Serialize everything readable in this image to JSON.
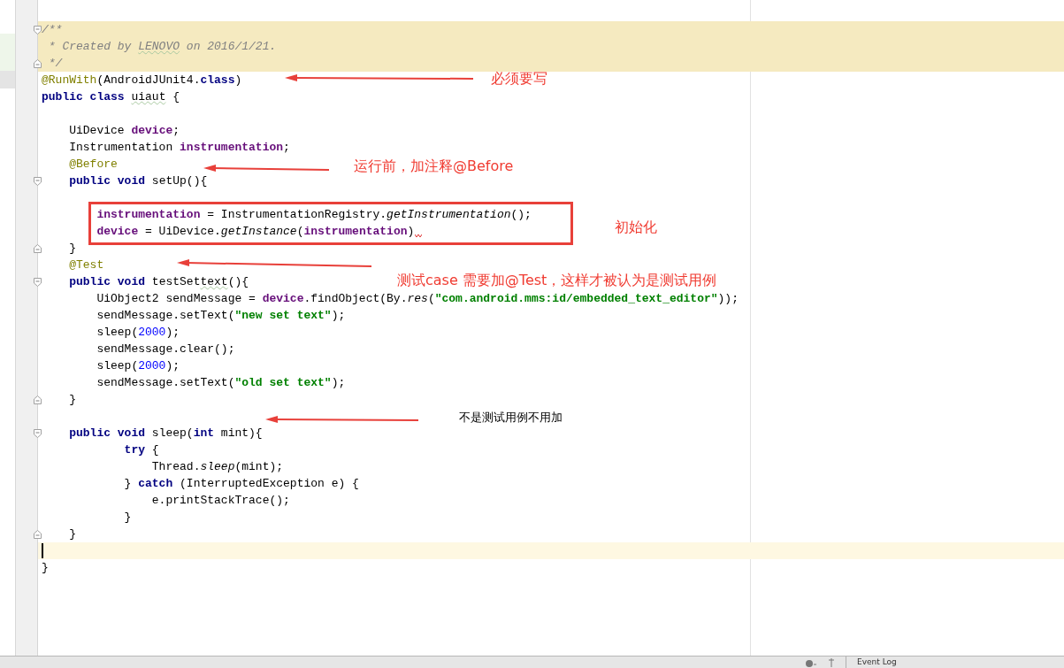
{
  "editor": {
    "lines": [
      {
        "highlighted": true,
        "fold_start": true,
        "tokens": [
          {
            "kind": "comment",
            "text": "/**"
          }
        ]
      },
      {
        "highlighted": true,
        "tokens": [
          {
            "kind": "comment",
            "text": " * Created by "
          },
          {
            "kind": "comment",
            "text": "LENOVO",
            "typo": true
          },
          {
            "kind": "comment",
            "text": " on 2016/1/21."
          }
        ]
      },
      {
        "highlighted": true,
        "fold_end": true,
        "tokens": [
          {
            "kind": "comment",
            "text": " */"
          }
        ]
      },
      {
        "tokens": [
          {
            "kind": "annotation",
            "text": "@RunWith"
          },
          {
            "kind": "plain",
            "text": "(AndroidJUnit4."
          },
          {
            "kind": "keyword",
            "text": "class"
          },
          {
            "kind": "plain",
            "text": ")"
          }
        ]
      },
      {
        "tokens": [
          {
            "kind": "keyword",
            "text": "public class "
          },
          {
            "kind": "plain",
            "text": "uiaut",
            "typo": true
          },
          {
            "kind": "plain",
            "text": " {"
          }
        ]
      },
      {
        "blank_line_before": true,
        "tokens": [
          {
            "kind": "plain",
            "text": "    UiDevice "
          },
          {
            "kind": "field",
            "text": "device"
          },
          {
            "kind": "plain",
            "text": ";"
          }
        ]
      },
      {
        "tokens": [
          {
            "kind": "plain",
            "text": "    Instrumentation "
          },
          {
            "kind": "field",
            "text": "instrumentation"
          },
          {
            "kind": "plain",
            "text": ";"
          }
        ]
      },
      {
        "tokens": [
          {
            "kind": "annotation",
            "text": "    @Before"
          }
        ]
      },
      {
        "fold_start": true,
        "tokens": [
          {
            "kind": "keyword",
            "text": "    public void "
          },
          {
            "kind": "plain",
            "text": "setUp(){"
          }
        ]
      },
      {
        "blank_line_before": true,
        "tokens": [
          {
            "kind": "field",
            "text": "        instrumentation"
          },
          {
            "kind": "plain",
            "text": " = InstrumentationRegistry."
          },
          {
            "kind": "italic",
            "text": "getInstrumentation"
          },
          {
            "kind": "plain",
            "text": "();"
          }
        ]
      },
      {
        "error": true,
        "tokens": [
          {
            "kind": "field",
            "text": "        device"
          },
          {
            "kind": "plain",
            "text": " = UiDevice."
          },
          {
            "kind": "italic",
            "text": "getInstance"
          },
          {
            "kind": "plain",
            "text": "("
          },
          {
            "kind": "field",
            "text": "instrumentation"
          },
          {
            "kind": "plain",
            "text": ")"
          }
        ]
      },
      {
        "fold_end": true,
        "tokens": [
          {
            "kind": "plain",
            "text": "    }"
          }
        ]
      },
      {
        "tokens": [
          {
            "kind": "annotation",
            "text": "    @Test"
          }
        ]
      },
      {
        "fold_start": true,
        "tokens": [
          {
            "kind": "keyword",
            "text": "    public void "
          },
          {
            "kind": "plain",
            "text": "testSet"
          },
          {
            "kind": "plain",
            "text": "text",
            "typo": true
          },
          {
            "kind": "plain",
            "text": "(){"
          }
        ]
      },
      {
        "tokens": [
          {
            "kind": "plain",
            "text": "        UiObject2 sendMessage = "
          },
          {
            "kind": "field",
            "text": "device"
          },
          {
            "kind": "plain",
            "text": ".findObject(By."
          },
          {
            "kind": "italic",
            "text": "res"
          },
          {
            "kind": "plain",
            "text": "("
          },
          {
            "kind": "string",
            "text": "\"com.android.mms:id/embedded_text_editor\""
          },
          {
            "kind": "plain",
            "text": "));"
          }
        ]
      },
      {
        "tokens": [
          {
            "kind": "plain",
            "text": "        sendMessage.setText("
          },
          {
            "kind": "string",
            "text": "\"new set text\""
          },
          {
            "kind": "plain",
            "text": ");"
          }
        ]
      },
      {
        "tokens": [
          {
            "kind": "plain",
            "text": "        sleep("
          },
          {
            "kind": "number",
            "text": "2000"
          },
          {
            "kind": "plain",
            "text": ");"
          }
        ]
      },
      {
        "tokens": [
          {
            "kind": "plain",
            "text": "        sendMessage.clear();"
          }
        ]
      },
      {
        "tokens": [
          {
            "kind": "plain",
            "text": "        sleep("
          },
          {
            "kind": "number",
            "text": "2000"
          },
          {
            "kind": "plain",
            "text": ");"
          }
        ]
      },
      {
        "tokens": [
          {
            "kind": "plain",
            "text": "        sendMessage.setText("
          },
          {
            "kind": "string",
            "text": "\"old set text\""
          },
          {
            "kind": "plain",
            "text": ");"
          }
        ]
      },
      {
        "fold_end": true,
        "tokens": [
          {
            "kind": "plain",
            "text": "    }"
          }
        ]
      },
      {
        "blank_line_before": true,
        "fold_start": true,
        "tokens": [
          {
            "kind": "keyword",
            "text": "    public void "
          },
          {
            "kind": "plain",
            "text": "sleep("
          },
          {
            "kind": "keyword",
            "text": "int "
          },
          {
            "kind": "plain",
            "text": "mint){"
          }
        ]
      },
      {
        "tokens": [
          {
            "kind": "keyword",
            "text": "            try "
          },
          {
            "kind": "plain",
            "text": "{"
          }
        ]
      },
      {
        "tokens": [
          {
            "kind": "plain",
            "text": "                Thread."
          },
          {
            "kind": "italic",
            "text": "sleep"
          },
          {
            "kind": "plain",
            "text": "(mint);"
          }
        ]
      },
      {
        "tokens": [
          {
            "kind": "plain",
            "text": "            } "
          },
          {
            "kind": "keyword",
            "text": "catch "
          },
          {
            "kind": "plain",
            "text": "(InterruptedException e) {"
          }
        ]
      },
      {
        "tokens": [
          {
            "kind": "plain",
            "text": "                e.printStackTrace();"
          }
        ]
      },
      {
        "tokens": [
          {
            "kind": "plain",
            "text": "            }"
          }
        ]
      },
      {
        "fold_end": true,
        "tokens": [
          {
            "kind": "plain",
            "text": "    }"
          }
        ]
      },
      {
        "current": true
      },
      {
        "tokens": [
          {
            "kind": "plain",
            "text": "}"
          }
        ]
      }
    ]
  },
  "annotations": [
    {
      "kind": "arrow"
    },
    {
      "kind": "note",
      "text": "必须要写",
      "color": "#f03c32"
    },
    {
      "kind": "arrow"
    },
    {
      "kind": "note",
      "text": "运行前，加注释@Before",
      "color": "#f03c32"
    },
    {
      "kind": "box"
    },
    {
      "kind": "note",
      "text": "初始化",
      "color": "#f03c32"
    },
    {
      "kind": "arrow"
    },
    {
      "kind": "note",
      "text": "测试case 需要加@Test，这样才被认为是测试用例",
      "color": "#f03c32"
    },
    {
      "kind": "arrow"
    },
    {
      "kind": "note",
      "text": "不是测试用例不用加",
      "color": "#000000"
    }
  ],
  "status_bar": {
    "tab": "Event Log"
  }
}
